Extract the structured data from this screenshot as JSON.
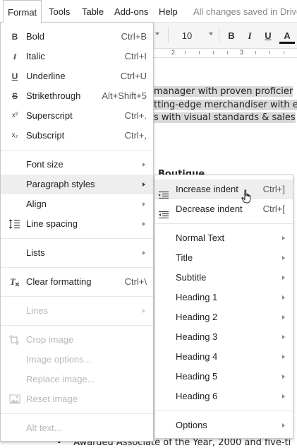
{
  "menubar": {
    "items": [
      {
        "name": "menu-format",
        "label": "Format"
      },
      {
        "name": "menu-tools",
        "label": "Tools"
      },
      {
        "name": "menu-table",
        "label": "Table"
      },
      {
        "name": "menu-addons",
        "label": "Add-ons"
      },
      {
        "name": "menu-help",
        "label": "Help"
      }
    ],
    "status": "All changes saved in Drive"
  },
  "toolbar": {
    "font_size": "10",
    "bold": "B",
    "italic": "I",
    "underline": "U",
    "text_color": "A",
    "ruler_numbers": [
      "2",
      "3"
    ]
  },
  "document": {
    "lines": [
      " manager with proven proficier",
      "tting-edge merchandiser with e",
      "s with visual standards & sales",
      "Boutique",
      "Awarded Associate of the Year, 2000 and five-ti"
    ]
  },
  "format_menu": {
    "items": [
      {
        "icon": "B",
        "label": "Bold",
        "shortcut": "Ctrl+B"
      },
      {
        "icon": "I",
        "label": "Italic",
        "shortcut": "Ctrl+I"
      },
      {
        "icon": "U",
        "label": "Underline",
        "shortcut": "Ctrl+U"
      },
      {
        "icon": "S",
        "label": "Strikethrough",
        "shortcut": "Alt+Shift+5"
      },
      {
        "icon": "x²",
        "label": "Superscript",
        "shortcut": "Ctrl+."
      },
      {
        "icon": "x₂",
        "label": "Subscript",
        "shortcut": "Ctrl+,"
      },
      {
        "label": "Font size"
      },
      {
        "label": "Paragraph styles"
      },
      {
        "label": "Align"
      },
      {
        "label": "Line spacing"
      },
      {
        "label": "Lists"
      },
      {
        "label": "Clear formatting",
        "shortcut": "Ctrl+\\"
      },
      {
        "label": "Lines"
      },
      {
        "label": "Crop image"
      },
      {
        "label": "Image options..."
      },
      {
        "label": "Replace image..."
      },
      {
        "label": "Reset image"
      },
      {
        "label": "Alt text..."
      }
    ]
  },
  "paragraph_submenu": {
    "items": [
      {
        "label": "Increase indent",
        "shortcut": "Ctrl+]"
      },
      {
        "label": "Decrease indent",
        "shortcut": "Ctrl+["
      },
      {
        "label": "Normal Text"
      },
      {
        "label": "Title"
      },
      {
        "label": "Subtitle"
      },
      {
        "label": "Heading 1"
      },
      {
        "label": "Heading 2"
      },
      {
        "label": "Heading 3"
      },
      {
        "label": "Heading 4"
      },
      {
        "label": "Heading 5"
      },
      {
        "label": "Heading 6"
      },
      {
        "label": "Options"
      }
    ]
  },
  "colors": {
    "text_color_bar": "#111111",
    "highlight": "#eeeeee",
    "disabled_text": "#b8b8b8"
  }
}
